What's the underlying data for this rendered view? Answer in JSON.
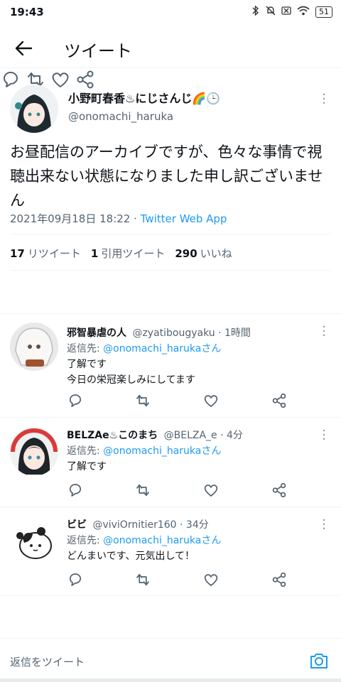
{
  "status_bar": {
    "time": "19:43",
    "battery": "51"
  },
  "header": {
    "title": "ツイート"
  },
  "tweet": {
    "display_name": "小野町春香♨にじさんじ🌈🕒",
    "handle": "@onomachi_haruka",
    "text": "お昼配信のアーカイブですが、色々な事情で視聴出来ない状態になりました申し訳ございません",
    "timestamp": "2021年09月18日 18:22",
    "separator": " · ",
    "source": "Twitter Web App",
    "retweets": {
      "count": "17",
      "label": "リツイート"
    },
    "quotes": {
      "count": "1",
      "label": "引用ツイート"
    },
    "likes": {
      "count": "290",
      "label": "いいね"
    }
  },
  "replies": [
    {
      "display_name": "邪智暴虐の人",
      "handle_time": "@zyatibougyaku · 1時間",
      "reply_prefix": "返信先: ",
      "reply_to": "@onomachi_harukaさん",
      "text_lines": [
        "了解です",
        "今日の栄冠楽しみにしてます"
      ]
    },
    {
      "display_name": "BELZAe♨このまち",
      "handle_time": "@BELZA_e · 4分",
      "reply_prefix": "返信先: ",
      "reply_to": "@onomachi_harukaさん",
      "text_lines": [
        "了解です"
      ]
    },
    {
      "display_name": "ビビ",
      "handle_time": "@viviOrnitier160 · 34分",
      "reply_prefix": "返信先: ",
      "reply_to": "@onomachi_harukaさん",
      "text_lines": [
        "どんまいです、元気出して！"
      ]
    }
  ],
  "composer": {
    "placeholder": "返信をツイート"
  },
  "colors": {
    "accent": "#1d9bf0",
    "secondary_text": "#536471"
  }
}
